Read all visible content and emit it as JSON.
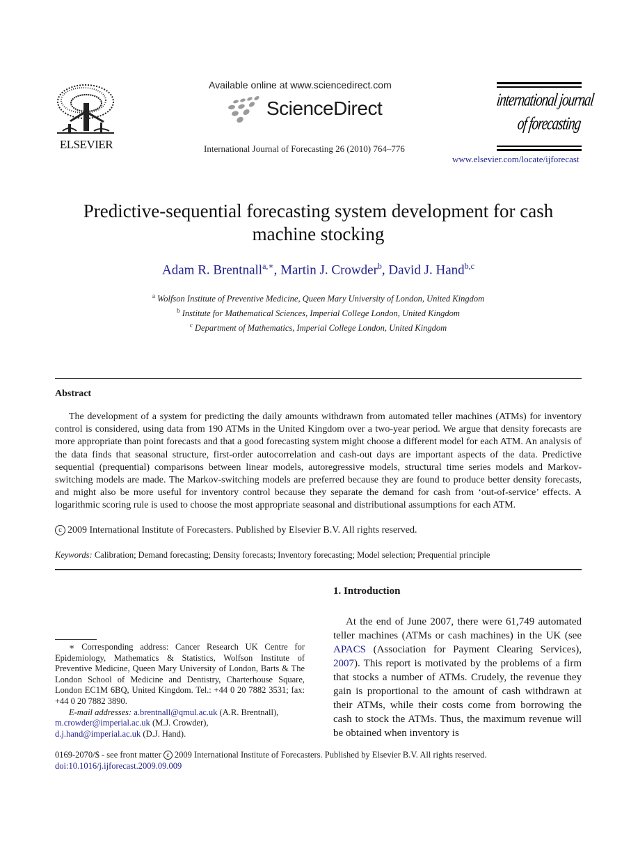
{
  "header": {
    "publisher_logo_text": "ELSEVIER",
    "available_online": "Available online at www.sciencedirect.com",
    "sciencedirect_name": "ScienceDirect",
    "journal_reference": "International Journal of Forecasting 26 (2010) 764–776",
    "journal_logo_line1": "international journal",
    "journal_logo_line2": "of forecasting",
    "journal_url": "www.elsevier.com/locate/ijforecast"
  },
  "title": "Predictive-sequential forecasting system development for cash machine stocking",
  "authors": [
    {
      "name": "Adam R. Brentnall",
      "sup": "a,∗"
    },
    {
      "name": "Martin J. Crowder",
      "sup": "b"
    },
    {
      "name": "David J. Hand",
      "sup": "b,c"
    }
  ],
  "affiliations": [
    {
      "mark": "a",
      "text": "Wolfson Institute of Preventive Medicine, Queen Mary University of London, United Kingdom"
    },
    {
      "mark": "b",
      "text": "Institute for Mathematical Sciences, Imperial College London, United Kingdom"
    },
    {
      "mark": "c",
      "text": "Department of Mathematics, Imperial College London, United Kingdom"
    }
  ],
  "abstract": {
    "heading": "Abstract",
    "body": "The development of a system for predicting the daily amounts withdrawn from automated teller machines (ATMs) for inventory control is considered, using data from 190 ATMs in the United Kingdom over a two-year period. We argue that density forecasts are more appropriate than point forecasts and that a good forecasting system might choose a different model for each ATM. An analysis of the data finds that seasonal structure, first-order autocorrelation and cash-out days are important aspects of the data. Predictive sequential (prequential) comparisons between linear models, autoregressive models, structural time series models and Markov-switching models are made. The Markov-switching models are preferred because they are found to produce better density forecasts, and might also be more useful for inventory control because they separate the demand for cash from ‘out-of-service’ effects. A logarithmic scoring rule is used to choose the most appropriate seasonal and distributional assumptions for each ATM.",
    "copyright_symbol": "c",
    "copyright": "2009 International Institute of Forecasters. Published by Elsevier B.V. All rights reserved."
  },
  "keywords": {
    "label": "Keywords:",
    "text": "Calibration; Demand forecasting; Density forecasts; Inventory forecasting; Model selection; Prequential principle"
  },
  "footnote": {
    "corresponding": "∗ Corresponding address: Cancer Research UK Centre for Epidemiology, Mathematics & Statistics, Wolfson Institute of Preventive Medicine, Queen Mary University of London, Barts & The London School of Medicine and Dentistry, Charterhouse Square, London EC1M 6BQ, United Kingdom. Tel.: +44 0 20 7882 3531; fax: +44 0 20 7882 3890.",
    "email_label": "E-mail addresses:",
    "emails": [
      {
        "address": "a.brentnall@qmul.ac.uk",
        "owner": " (A.R. Brentnall),"
      },
      {
        "address": "m.crowder@imperial.ac.uk",
        "owner": " (M.J. Crowder),"
      },
      {
        "address": "d.j.hand@imperial.ac.uk",
        "owner": " (D.J. Hand)."
      }
    ]
  },
  "introduction": {
    "heading": "1.  Introduction",
    "text_1": "At the end of June 2007, there were 61,749 automated teller machines (ATMs or cash machines) in the UK (see ",
    "link_apacs": "APACS",
    "text_2": " (Association for Payment Clearing Services), ",
    "link_year": "2007",
    "text_3": "). This report is motivated by the problems of a firm that stocks a number of ATMs. Crudely, the revenue they gain is proportional to the amount of cash withdrawn at their ATMs, while their costs come from borrowing the cash to stock the ATMs. Thus, the maximum revenue will be obtained when inventory is"
  },
  "bottom": {
    "front_matter_prefix": "0169-2070/$ - see front matter",
    "copyright_symbol": "c",
    "front_matter_suffix": "2009 International Institute of Forecasters. Published by Elsevier B.V. All rights reserved.",
    "doi": "doi:10.1016/j.ijforecast.2009.09.009"
  },
  "colors": {
    "link": "#1f1f8c",
    "text": "#1a1a1a"
  }
}
